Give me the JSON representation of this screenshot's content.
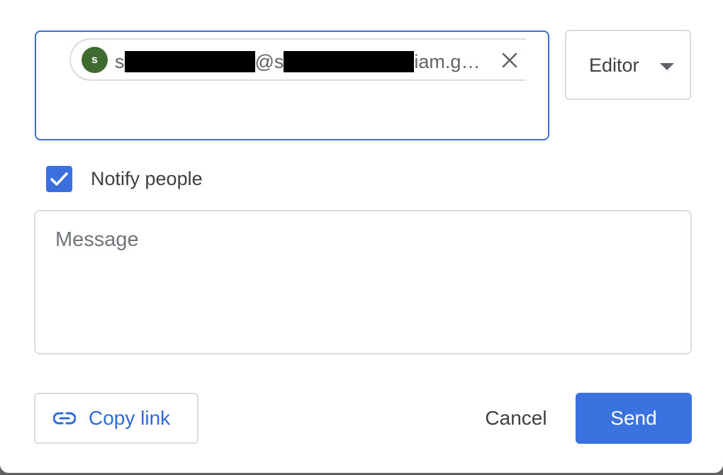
{
  "share_dialog": {
    "recipient_chip": {
      "avatar_initial": "s",
      "email_prefix": "s",
      "email_at": "@s",
      "email_suffix": "iam.g…",
      "avatar_color": "#3f6b30"
    },
    "role": {
      "selected": "Editor"
    },
    "notify": {
      "label": "Notify people",
      "checked": true
    },
    "message": {
      "placeholder": "Message",
      "value": ""
    },
    "footer": {
      "copy_link_label": "Copy link",
      "cancel_label": "Cancel",
      "send_label": "Send"
    },
    "colors": {
      "accent": "#3a73e0",
      "focus_border": "#3a6fcb",
      "link_text": "#2f6bd8"
    },
    "icons": {
      "remove_chip": "close-icon",
      "role_dropdown": "caret-down-icon",
      "notify_check": "checkmark-icon",
      "copy_link": "link-icon"
    }
  }
}
